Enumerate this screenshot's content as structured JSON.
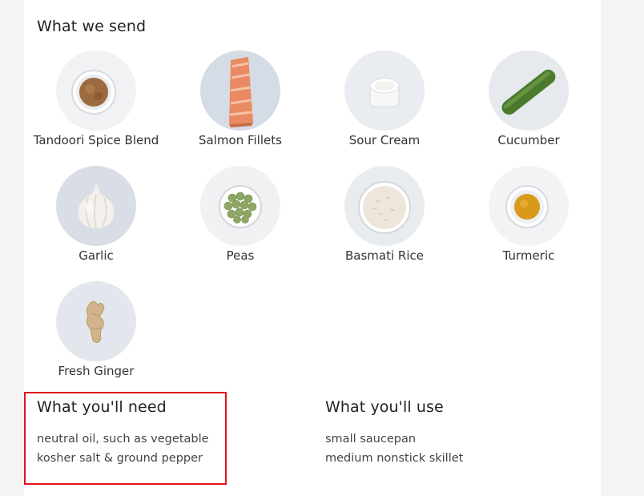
{
  "what_we_send": {
    "title": "What we send",
    "items": [
      {
        "label": "Tandoori Spice Blend",
        "icon": "tandoori-spice-icon"
      },
      {
        "label": "Salmon Fillets",
        "icon": "salmon-fillet-icon"
      },
      {
        "label": "Sour Cream",
        "icon": "sour-cream-icon"
      },
      {
        "label": "Cucumber",
        "icon": "cucumber-icon"
      },
      {
        "label": "Garlic",
        "icon": "garlic-icon"
      },
      {
        "label": "Peas",
        "icon": "peas-icon"
      },
      {
        "label": "Basmati Rice",
        "icon": "basmati-rice-icon"
      },
      {
        "label": "Turmeric",
        "icon": "turmeric-icon"
      },
      {
        "label": "Fresh Ginger",
        "icon": "ginger-icon"
      }
    ]
  },
  "what_youll_need": {
    "title": "What you'll need",
    "items": [
      "neutral oil, such as vegetable",
      "kosher salt & ground pepper"
    ]
  },
  "what_youll_use": {
    "title": "What you'll use",
    "items": [
      "small saucepan",
      "medium nonstick skillet"
    ]
  },
  "colors": {
    "page_bg": "#f4f4f5",
    "card_bg": "#ffffff",
    "circle_bg": "#eef0f3",
    "highlight": "#e0151a"
  }
}
